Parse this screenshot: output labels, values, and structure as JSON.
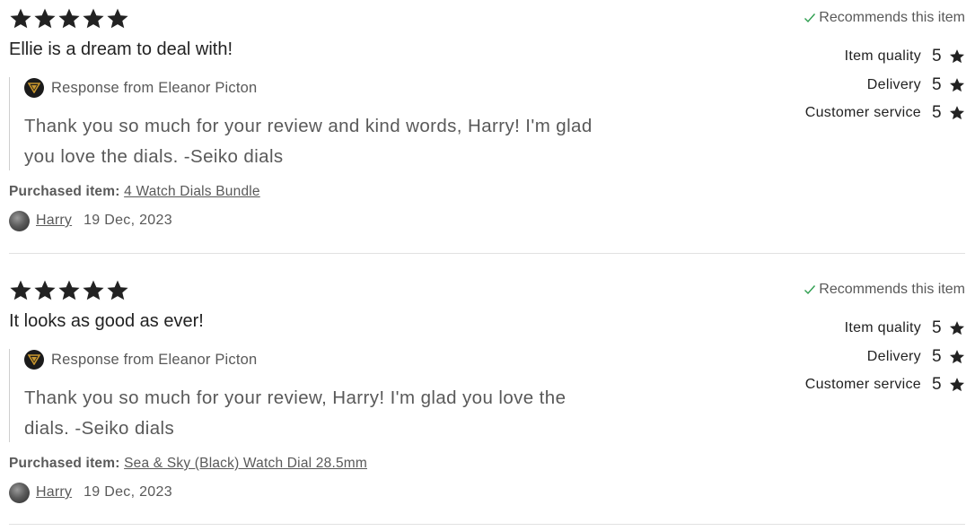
{
  "reviews": [
    {
      "stars": 5,
      "title": "Ellie is a dream to deal with!",
      "recommends": "Recommends this item",
      "ratings": [
        {
          "label": "Item quality",
          "value": "5"
        },
        {
          "label": "Delivery",
          "value": "5"
        },
        {
          "label": "Customer service",
          "value": "5"
        }
      ],
      "response": {
        "from": "Response from Eleanor Picton",
        "text": "Thank you so much for your review and kind words, Harry! I'm glad you love the dials. -Seiko dials"
      },
      "purchased_label": "Purchased item:",
      "purchased_item": "4 Watch Dials Bundle",
      "reviewer": "Harry",
      "date": "19 Dec, 2023"
    },
    {
      "stars": 5,
      "title": "It looks as good as ever!",
      "recommends": "Recommends this item",
      "ratings": [
        {
          "label": "Item quality",
          "value": "5"
        },
        {
          "label": "Delivery",
          "value": "5"
        },
        {
          "label": "Customer service",
          "value": "5"
        }
      ],
      "response": {
        "from": "Response from Eleanor Picton",
        "text": "Thank you so much for your review, Harry! I'm glad you love the dials. -Seiko dials"
      },
      "purchased_label": "Purchased item:",
      "purchased_item": "Sea & Sky (Black) Watch Dial 28.5mm",
      "reviewer": "Harry",
      "date": "19 Dec, 2023"
    }
  ],
  "icons": {
    "star": "star-icon",
    "check": "check-icon",
    "shop_logo": "shop-logo-icon"
  },
  "colors": {
    "text": "#222222",
    "muted": "#595959",
    "check": "#2e9e4f",
    "logo_gold": "#c8962e"
  }
}
